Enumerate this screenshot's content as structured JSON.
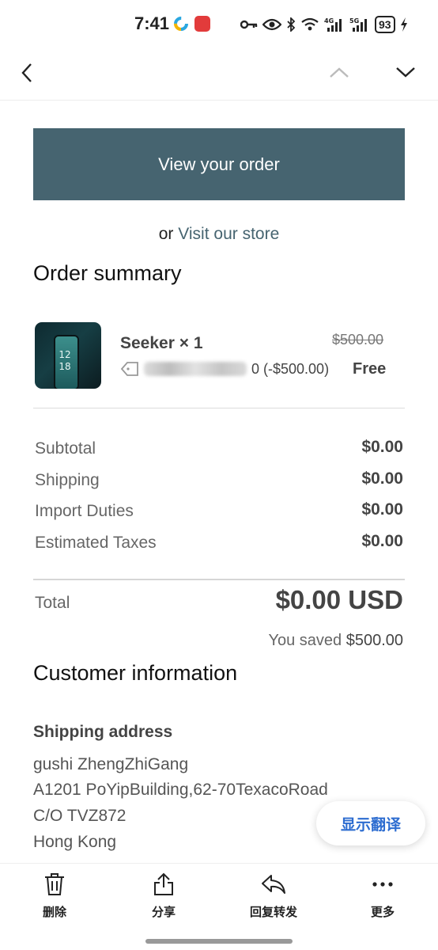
{
  "status_bar": {
    "time": "7:41",
    "battery": "93",
    "icons": [
      "key-icon",
      "eye-icon",
      "bluetooth-icon",
      "wifi-icon",
      "4g-signal-icon",
      "5g-signal-icon",
      "battery-icon",
      "charging-icon"
    ]
  },
  "nav": {
    "back_icon": "chevron-left-icon",
    "prev_icon": "chevron-up-icon",
    "next_icon": "chevron-down-icon"
  },
  "order": {
    "view_button": "View your order",
    "or_text": "or",
    "visit_link": "Visit our store",
    "accent_color": "#466470"
  },
  "summary": {
    "title": "Order summary",
    "product": {
      "name": "Seeker × 1",
      "discount_amount": "0 (-$500.00)",
      "original_price": "$500.00",
      "price": "Free",
      "thumb_time_top": "12",
      "thumb_time_bottom": "18"
    },
    "rows": [
      {
        "label": "Subtotal",
        "value": "$0.00"
      },
      {
        "label": "Shipping",
        "value": "$0.00"
      },
      {
        "label": "Import Duties",
        "value": "$0.00"
      },
      {
        "label": "Estimated Taxes",
        "value": "$0.00"
      }
    ],
    "total_label": "Total",
    "total_value": "$0.00 USD",
    "saved_prefix": "You saved",
    "saved_amount": "$500.00"
  },
  "customer": {
    "title": "Customer information",
    "shipping_title": "Shipping address",
    "address_lines": [
      "gushi ZhengZhiGang",
      "A1201 PoYipBuilding,62-70TexacoRoad",
      "C/O TVZ872",
      "Hong Kong"
    ]
  },
  "translate_button": "显示翻译",
  "toolbar": {
    "delete": "删除",
    "share": "分享",
    "reply_forward": "回复转发",
    "more": "更多"
  }
}
